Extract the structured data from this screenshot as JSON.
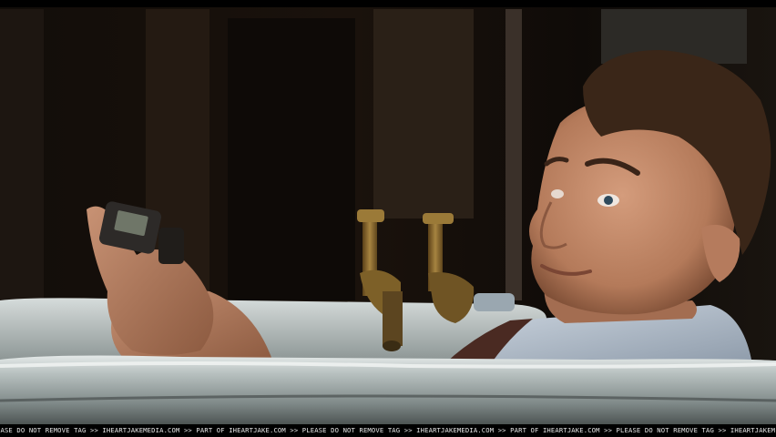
{
  "image": {
    "watermark_text": "EASE DO NOT REMOVE TAG >> IHEARTJAKEMEDIA.COM >> PART OF IHEARTJAKE.COM >> PLEASE DO NOT REMOVE TAG >> IHEARTJAKEMEDIA.COM >> PART OF IHEARTJAKE.COM >> PLEASE DO NOT REMOVE TAG >> IHEARTJAKEM",
    "palette": {
      "background": "#0b0806",
      "tub_enamel": "#c9d0cf",
      "brass": "#8a6a2c",
      "skin": "#c08a6a",
      "hair": "#3a2618",
      "shirt": "#b9c4d0"
    }
  }
}
